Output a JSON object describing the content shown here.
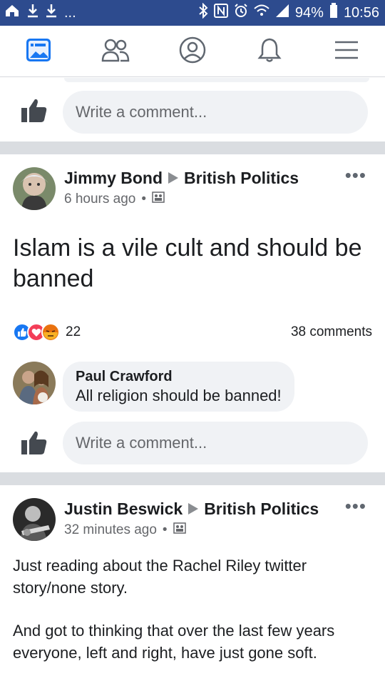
{
  "status": {
    "battery": "94%",
    "time": "10:56",
    "left_dots": "..."
  },
  "nav": {
    "items": [
      "news-feed",
      "friends",
      "profile",
      "notifications",
      "menu"
    ]
  },
  "top_card": {
    "comment_placeholder": "Write a comment..."
  },
  "post1": {
    "author": "Jimmy Bond",
    "group": "British Politics",
    "time": "6 hours ago",
    "body": "Islam is a vile cult and should be banned",
    "reaction_count": "22",
    "comments_count": "38 comments",
    "comment": {
      "author": "Paul Crawford",
      "text": "All religion should be banned!"
    },
    "comment_placeholder": "Write a comment..."
  },
  "post2": {
    "author": "Justin Beswick",
    "group": "British Politics",
    "time": "32 minutes ago",
    "body_p1": "Just reading about the Rachel Riley twitter story/none story.",
    "body_p2": "And got to thinking that over the last few years everyone, left and right, have just gone soft."
  },
  "colors": {
    "status_bar": "#2d4b8e",
    "fb_blue": "#1877f2",
    "separator": "#dadde1",
    "meta_gray": "#65676b"
  }
}
